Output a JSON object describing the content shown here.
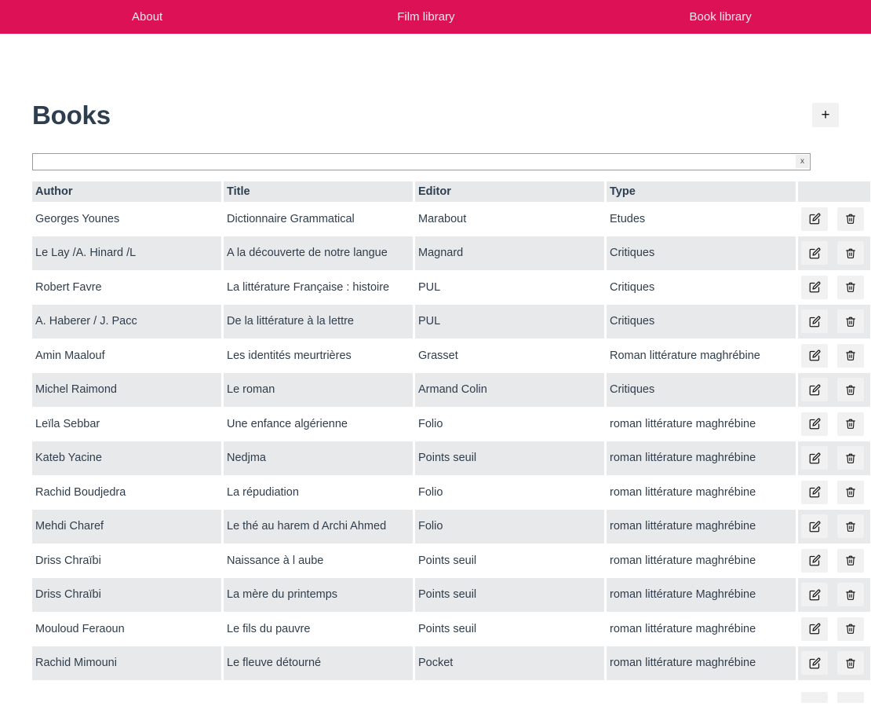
{
  "nav": {
    "background": "#dd1155",
    "items": [
      {
        "label": "About",
        "name": "nav-about"
      },
      {
        "label": "Film library",
        "name": "nav-film-library"
      },
      {
        "label": "Book library",
        "name": "nav-book-library"
      }
    ]
  },
  "header": {
    "title": "Books",
    "title_color": "#2c3e50",
    "add_button": {
      "label": "+",
      "icon": "plus-icon"
    }
  },
  "search": {
    "value": "",
    "placeholder": "",
    "clear_label": "x"
  },
  "table": {
    "columns": [
      "Author",
      "Title",
      "Editor",
      "Type"
    ],
    "row_actions": {
      "edit_icon": "edit-pencil-icon",
      "delete_icon": "trash-icon"
    },
    "rows": [
      {
        "author": "Georges Younes",
        "title": "Dictionnaire Grammatical",
        "editor": "Marabout",
        "type": "Etudes"
      },
      {
        "author": "Le Lay /A. Hinard /L",
        "title": "A la découverte de notre langue",
        "editor": "Magnard",
        "type": "Critiques"
      },
      {
        "author": "Robert Favre",
        "title": "La littérature Française : histoire",
        "editor": "PUL",
        "type": "Critiques"
      },
      {
        "author": "A. Haberer / J. Pacc",
        "title": "De la littérature à la lettre",
        "editor": "PUL",
        "type": "Critiques"
      },
      {
        "author": "Amin Maalouf",
        "title": "Les identités meurtrières",
        "editor": "Grasset",
        "type": "Roman littérature maghrébine"
      },
      {
        "author": "Michel Raimond",
        "title": "Le roman",
        "editor": "Armand Colin",
        "type": "Critiques"
      },
      {
        "author": "Leïla Sebbar",
        "title": "Une enfance algérienne",
        "editor": "Folio",
        "type": "roman littérature maghrébine"
      },
      {
        "author": "Kateb Yacine",
        "title": "Nedjma",
        "editor": "Points seuil",
        "type": "roman littérature maghrébine"
      },
      {
        "author": "Rachid Boudjedra",
        "title": "La répudiation",
        "editor": "Folio",
        "type": "roman littérature maghrébine"
      },
      {
        "author": "Mehdi Charef",
        "title": "Le thé au harem d Archi Ahmed",
        "editor": "Folio",
        "type": "roman littérature maghrébine"
      },
      {
        "author": "Driss Chraïbi",
        "title": "Naissance à l aube",
        "editor": "Points seuil",
        "type": "roman littérature maghrébine"
      },
      {
        "author": "Driss Chraïbi",
        "title": "La mère du printemps",
        "editor": "Points seuil",
        "type": "roman littérature Maghrébine"
      },
      {
        "author": "Mouloud Feraoun",
        "title": "Le fils du pauvre",
        "editor": "Points seuil",
        "type": "roman littérature maghrébine"
      },
      {
        "author": "Rachid Mimouni",
        "title": "Le fleuve détourné",
        "editor": "Pocket",
        "type": "roman littérature maghrébine"
      }
    ]
  }
}
